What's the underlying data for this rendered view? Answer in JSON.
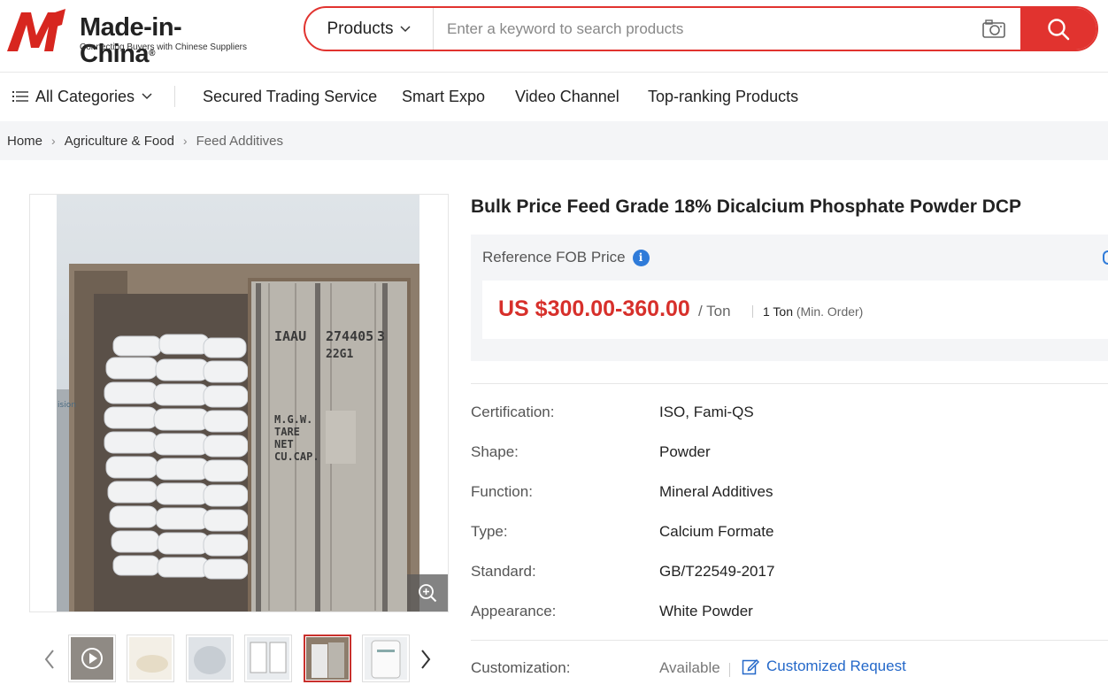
{
  "header": {
    "logo_text": "Made-in-China",
    "logo_reg": "®",
    "logo_tagline": "Connecting Buyers with Chinese Suppliers",
    "search": {
      "category": "Products",
      "placeholder": "Enter a keyword to search products"
    }
  },
  "nav": {
    "all_categories": "All Categories",
    "links": [
      "Secured Trading Service",
      "Smart Expo",
      "Video Channel",
      "Top-ranking Products"
    ]
  },
  "breadcrumb": [
    "Home",
    "Agriculture & Food",
    "Feed Additives"
  ],
  "product": {
    "title": "Bulk Price Feed Grade 18% Dicalcium Phosphate Powder DCP",
    "price_label": "Reference FOB Price",
    "price": "US $300.00-360.00",
    "price_unit": "/ Ton",
    "moq": "1 Ton",
    "moq_note": "(Min. Order)",
    "attributes": [
      {
        "key": "Certification:",
        "value": "ISO, Fami-QS"
      },
      {
        "key": "Shape:",
        "value": "Powder"
      },
      {
        "key": "Function:",
        "value": "Mineral Additives"
      },
      {
        "key": "Type:",
        "value": "Calcium Formate"
      },
      {
        "key": "Standard:",
        "value": "GB/T22549-2017"
      },
      {
        "key": "Appearance:",
        "value": "White Powder"
      }
    ],
    "customization": {
      "key": "Customization:",
      "available": "Available",
      "link": "Customized Request"
    }
  },
  "container_markings": {
    "prefix": "IAAU",
    "number": "274405",
    "check": "3",
    "type_code": "22G1",
    "labels": [
      "M.G.W.",
      "TARE",
      "NET",
      "CU.CAP."
    ],
    "side_text": "ision"
  },
  "colors": {
    "brand_red": "#e1332f",
    "price_red": "#d7302b",
    "link_blue": "#2468c9"
  }
}
